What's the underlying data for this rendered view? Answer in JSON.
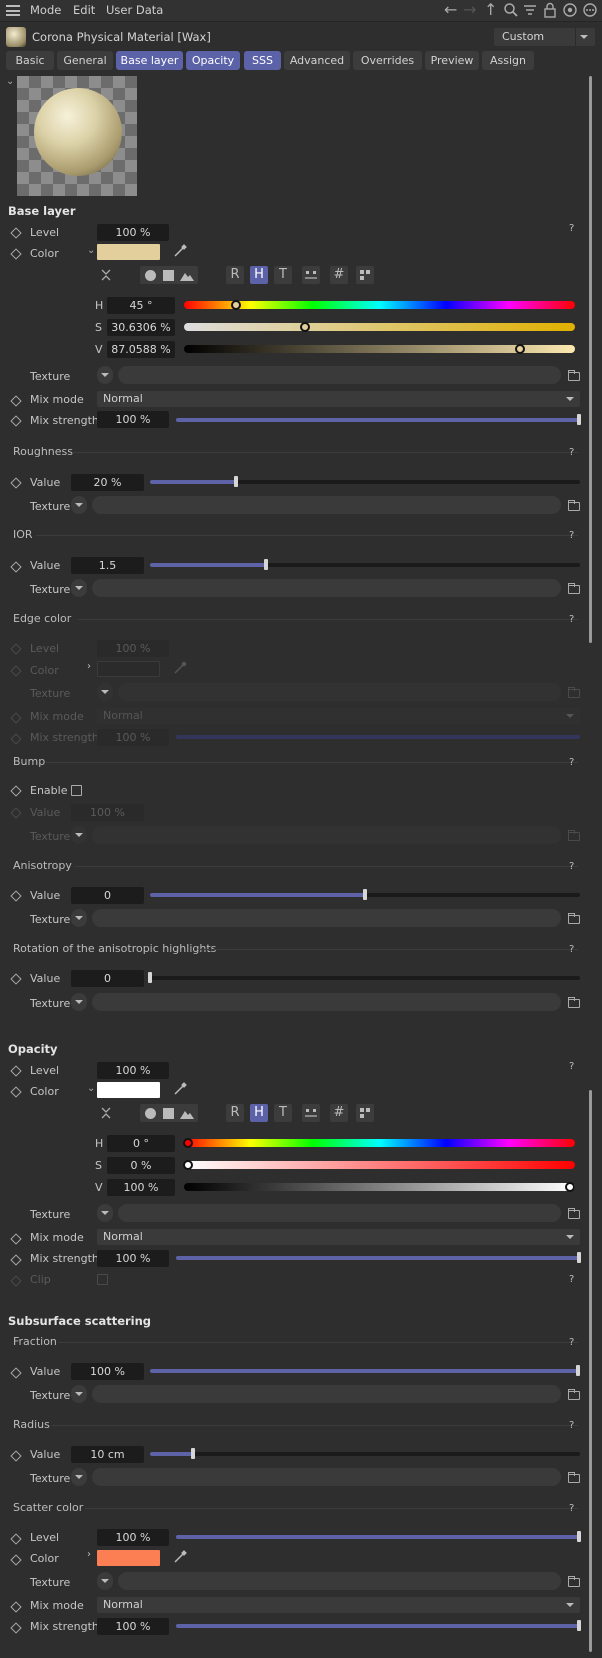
{
  "menu": {
    "mode": "Mode",
    "edit": "Edit",
    "user_data": "User Data"
  },
  "title": {
    "name": "Corona Physical Material [Wax]",
    "preset": "Custom"
  },
  "tabs": [
    "Basic",
    "General",
    "Base layer",
    "Opacity",
    "SSS",
    "Advanced",
    "Overrides",
    "Preview",
    "Assign"
  ],
  "active_tabs": [
    "Base layer",
    "Opacity",
    "SSS"
  ],
  "colors": {
    "accent": "#5c62a8",
    "base_color": "#e3cf9c",
    "opacity_color": "#ffffff",
    "scatter_color": "#fb7f53"
  },
  "base_layer": {
    "title": "Base layer",
    "level_label": "Level",
    "level_value": "100 %",
    "color_label": "Color",
    "h_label": "H",
    "h_value": "45 °",
    "s_label": "S",
    "s_value": "30.6306 %",
    "v_label": "V",
    "v_value": "87.0588 %",
    "texture_label": "Texture",
    "mix_mode_label": "Mix mode",
    "mix_mode_value": "Normal",
    "mix_strength_label": "Mix strength",
    "mix_strength_value": "100 %"
  },
  "roughness": {
    "title": "Roughness",
    "value_label": "Value",
    "value": "20 %",
    "fill": 0.2,
    "texture_label": "Texture"
  },
  "ior": {
    "title": "IOR",
    "value_label": "Value",
    "value": "1.5",
    "fill": 0.27,
    "texture_label": "Texture"
  },
  "edge_color": {
    "title": "Edge color",
    "level_label": "Level",
    "level_value": "100 %",
    "color_label": "Color",
    "texture_label": "Texture",
    "mix_mode_label": "Mix mode",
    "mix_mode_value": "Normal",
    "mix_strength_label": "Mix strength",
    "mix_strength_value": "100 %"
  },
  "bump": {
    "title": "Bump",
    "enable_label": "Enable",
    "value_label": "Value",
    "value": "100 %",
    "texture_label": "Texture"
  },
  "anisotropy": {
    "title": "Anisotropy",
    "value_label": "Value",
    "value": "0",
    "fill": 0.5,
    "texture_label": "Texture"
  },
  "rotation": {
    "title": "Rotation of the anisotropic highlights",
    "value_label": "Value",
    "value": "0",
    "fill": 0.0,
    "texture_label": "Texture"
  },
  "opacity": {
    "title": "Opacity",
    "level_label": "Level",
    "level_value": "100 %",
    "color_label": "Color",
    "h_label": "H",
    "h_value": "0 °",
    "s_label": "S",
    "s_value": "0 %",
    "v_label": "V",
    "v_value": "100 %",
    "texture_label": "Texture",
    "mix_mode_label": "Mix mode",
    "mix_mode_value": "Normal",
    "mix_strength_label": "Mix strength",
    "mix_strength_value": "100 %",
    "clip_label": "Clip"
  },
  "sss": {
    "title": "Subsurface scattering",
    "fraction": {
      "title": "Fraction",
      "value_label": "Value",
      "value": "100 %",
      "fill": 1.0,
      "texture_label": "Texture"
    },
    "radius": {
      "title": "Radius",
      "value_label": "Value",
      "value": "10 cm",
      "fill": 0.1,
      "texture_label": "Texture"
    },
    "scatter_color": {
      "title": "Scatter color",
      "level_label": "Level",
      "level_value": "100 %",
      "color_label": "Color",
      "texture_label": "Texture",
      "mix_mode_label": "Mix mode",
      "mix_mode_value": "Normal",
      "mix_strength_label": "Mix strength",
      "mix_strength_value": "100 %"
    }
  },
  "help": "?",
  "mode_buttons": [
    "R",
    "H",
    "T",
    "#"
  ]
}
